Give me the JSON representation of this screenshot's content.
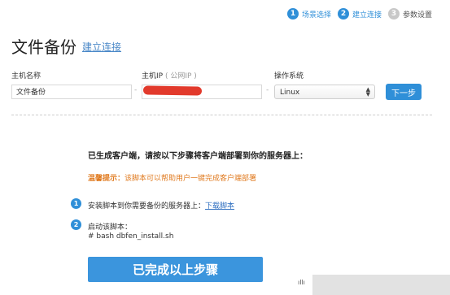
{
  "steps": [
    {
      "num": "1",
      "label": "场景选择",
      "state": "active"
    },
    {
      "num": "2",
      "label": "建立连接",
      "state": "active"
    },
    {
      "num": "3",
      "label": "参数设置",
      "state": "inactive"
    }
  ],
  "header": {
    "title": "文件备份",
    "subtitle_link": "建立连接"
  },
  "form": {
    "host_name_label": "主机名称",
    "host_name_value": "文件备份",
    "host_ip_label": "主机IP",
    "host_ip_hint": "( 公网IP )",
    "separator": "-",
    "os_label": "操作系统",
    "os_value": "Linux",
    "next_button": "下一步"
  },
  "instructions": {
    "title": "已生成客户端，请按以下步骤将客户端部署到你的服务器上：",
    "tip_label": "温馨提示：",
    "tip_text": "该脚本可以帮助用户一键完成客户端部署",
    "item1_num": "1",
    "item1_text": "安装脚本到你需要备份的服务器上：",
    "item1_link": "下载脚本",
    "item2_num": "2",
    "item2_line1": "启动该脚本：",
    "item2_line2": "# bash dbfen_install.sh",
    "done_button": "已完成以上步骤"
  },
  "corner_text": "ıllı",
  "colors": {
    "accent": "#2f8fd8",
    "tip": "#e07a1f",
    "redaction": "#e23a2c"
  }
}
